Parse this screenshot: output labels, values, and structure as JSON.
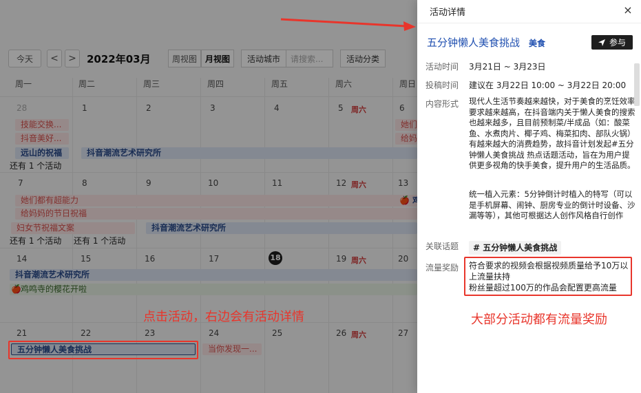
{
  "calendar": {
    "toolbar": {
      "today": "今天",
      "prev": "<",
      "next": ">",
      "month": "2022年03月",
      "week_view": "周视图",
      "month_view": "月视图",
      "city_label": "活动城市",
      "city_placeholder": "请搜索...",
      "category_label": "活动分类"
    },
    "weekdays": [
      "周一",
      "周二",
      "周三",
      "周四",
      "周五",
      "周六",
      "周日"
    ],
    "days": {
      "w1": [
        "28",
        "1",
        "2",
        "3",
        "4",
        "5",
        "6"
      ],
      "w2": [
        "7",
        "8",
        "9",
        "10",
        "11",
        "12",
        "13"
      ],
      "w3": [
        "14",
        "15",
        "16",
        "17",
        "18",
        "19",
        "20"
      ],
      "w4": [
        "21",
        "22",
        "23",
        "24",
        "25",
        "26",
        "27"
      ]
    },
    "holiday": "周六",
    "events": {
      "e1": "技能交换...",
      "e2": "抖音美好...",
      "e3": "远山的祝福",
      "e4": "抖音潮流艺术研究所",
      "e5": "她们都有超能力",
      "e6": "给妈妈的节日祝福",
      "e7": "妇女节祝福文案",
      "e8": "抖音潮流艺术研究所",
      "e9": "抖音潮流艺术研究所",
      "e10": "鸡鸣寺的樱花开啦",
      "e11": "五分钟懒人美食挑战",
      "e12": "当你发现一...",
      "e13": "她们",
      "e14": "给妈",
      "e15": "鸡"
    },
    "more": "还有 1 个活动"
  },
  "drawer": {
    "header": "活动详情",
    "close": "×",
    "title": "五分钟懒人美食挑战",
    "tag": "美食",
    "join": "参与",
    "time_label": "活动时间",
    "time_value": "3月21日 ~ 3月23日",
    "submit_label": "投稿时间",
    "submit_value": "建议在 3月22日 10:00 ~ 3月22日 20:00",
    "content_label": "内容形式",
    "content_p1": "现代人生活节奏越来越快，对于美食的烹饪效率要求越来越高，在抖音端内关于懒人美食的搜索也越来越多，且目前预制菜/半成品（如：酸菜鱼、水煮肉片、椰子鸡、梅菜扣肉、部队火锅）有越来越大的消费趋势，故抖音计划发起#五分钟懒人美食挑战 热点话题活动，旨在为用户提供更多视角的快手美食，提升用户的生活品质。",
    "content_p2": "统一植入元素：5分钟倒计时植入的特写（可以是手机屏幕、闹钟、厨房专业的倒计时设备、沙漏等等），其他可根据达人创作风格自行创作",
    "topic_label": "关联话题",
    "topic_value": "# 五分钟懒人美食挑战",
    "reward_label": "流量奖励",
    "reward_line1": "符合要求的视频会根据视频质量给予10万以上流量扶持",
    "reward_line2": "粉丝量超过100万的作品会配置更高流量"
  },
  "annotations": {
    "left": "点击活动，右边会有活动详情",
    "right": "大部分活动都有流量奖励"
  },
  "colors": {
    "accent_blue": "#1f4fb0",
    "annotation_red": "#e8352b",
    "holiday_red": "#d13b3b"
  }
}
